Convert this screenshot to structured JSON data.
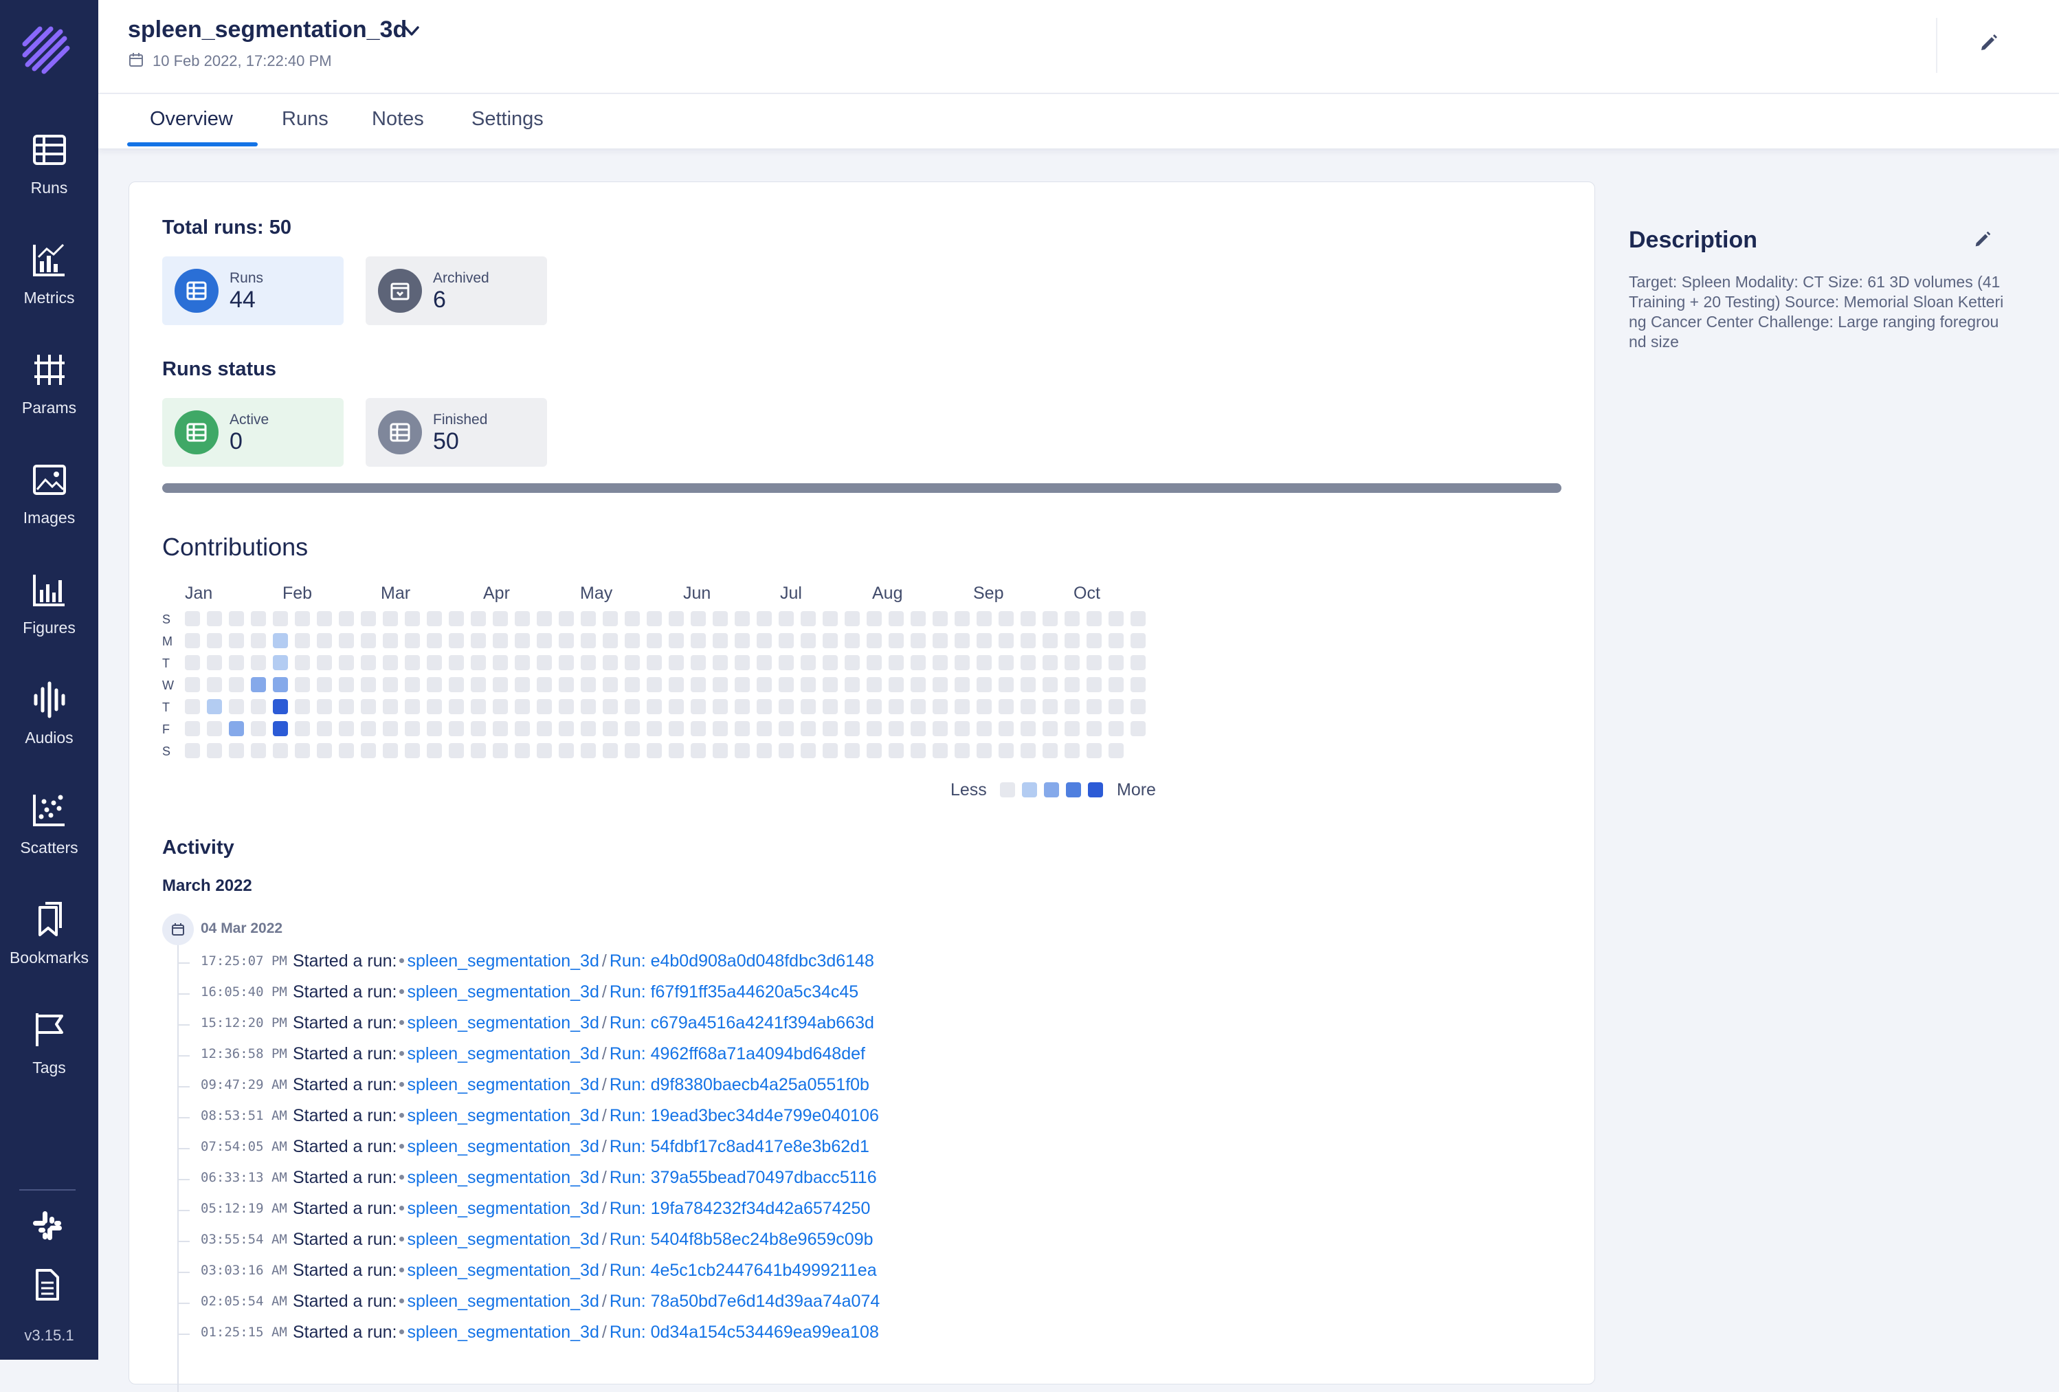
{
  "app": {
    "version": "v3.15.1"
  },
  "sidebar": {
    "items": [
      {
        "label": "Runs",
        "icon": "runs-table-icon"
      },
      {
        "label": "Metrics",
        "icon": "metrics-chart-icon"
      },
      {
        "label": "Params",
        "icon": "params-grid-icon"
      },
      {
        "label": "Images",
        "icon": "images-icon"
      },
      {
        "label": "Figures",
        "icon": "figures-chart-icon"
      },
      {
        "label": "Audios",
        "icon": "audio-wave-icon"
      },
      {
        "label": "Scatters",
        "icon": "scatter-icon"
      },
      {
        "label": "Bookmarks",
        "icon": "bookmark-icon"
      },
      {
        "label": "Tags",
        "icon": "flag-icon"
      }
    ],
    "footer_icons": [
      "slack-icon",
      "docs-icon"
    ]
  },
  "header": {
    "title": "spleen_segmentation_3d",
    "date": "10 Feb 2022, 17:22:40 PM"
  },
  "tabs": [
    {
      "label": "Overview",
      "active": true
    },
    {
      "label": "Runs",
      "active": false
    },
    {
      "label": "Notes",
      "active": false
    },
    {
      "label": "Settings",
      "active": false
    }
  ],
  "overview": {
    "total_runs_label": "Total runs: 50",
    "runs_card": {
      "label": "Runs",
      "value": "44"
    },
    "archived_card": {
      "label": "Archived",
      "value": "6"
    },
    "status_title": "Runs status",
    "active_card": {
      "label": "Active",
      "value": "0"
    },
    "finished_card": {
      "label": "Finished",
      "value": "50"
    },
    "finished_fraction": 1.0
  },
  "contributions": {
    "title": "Contributions",
    "months": [
      "Jan",
      "Feb",
      "Mar",
      "Apr",
      "May",
      "Jun",
      "Jul",
      "Aug",
      "Sep",
      "Oct"
    ],
    "weekdays": [
      "S",
      "M",
      "T",
      "W",
      "T",
      "F",
      "S"
    ],
    "weeks": 44,
    "last_week_days": 7,
    "last_row_weeks": 43,
    "highlights": [
      {
        "week": 1,
        "day": 4,
        "level": 1
      },
      {
        "week": 2,
        "day": 5,
        "level": 2
      },
      {
        "week": 3,
        "day": 3,
        "level": 2
      },
      {
        "week": 4,
        "day": 1,
        "level": 1
      },
      {
        "week": 4,
        "day": 2,
        "level": 1
      },
      {
        "week": 4,
        "day": 3,
        "level": 2
      },
      {
        "week": 4,
        "day": 4,
        "level": 4
      },
      {
        "week": 4,
        "day": 5,
        "level": 4
      }
    ],
    "legend_less": "Less",
    "legend_more": "More",
    "colors": [
      "#e6e8ee",
      "#b3ccf2",
      "#85a9ea",
      "#4f7fdf",
      "#2c5bd6"
    ]
  },
  "activity": {
    "title": "Activity",
    "month_group": "March 2022",
    "day": "04 Mar 2022",
    "action_text": "Started a run:",
    "experiment": "spleen_segmentation_3d",
    "entries": [
      {
        "time": "17:25:07 PM",
        "run": "Run: e4b0d908a0d048fdbc3d6148"
      },
      {
        "time": "16:05:40 PM",
        "run": "Run: f67f91ff35a44620a5c34c45"
      },
      {
        "time": "15:12:20 PM",
        "run": "Run: c679a4516a4241f394ab663d"
      },
      {
        "time": "12:36:58 PM",
        "run": "Run: 4962ff68a71a4094bd648def"
      },
      {
        "time": "09:47:29 AM",
        "run": "Run: d9f8380baecb4a25a0551f0b"
      },
      {
        "time": "08:53:51 AM",
        "run": "Run: 19ead3bec34d4e799e040106"
      },
      {
        "time": "07:54:05 AM",
        "run": "Run: 54fdbf17c8ad417e8e3b62d1"
      },
      {
        "time": "06:33:13 AM",
        "run": "Run: 379a55bead70497dbacc5116"
      },
      {
        "time": "05:12:19 AM",
        "run": "Run: 19fa784232f34d42a6574250"
      },
      {
        "time": "03:55:54 AM",
        "run": "Run: 5404f8b58ec24b8e9659c09b"
      },
      {
        "time": "03:03:16 AM",
        "run": "Run: 4e5c1cb2447641b4999211ea"
      },
      {
        "time": "02:05:54 AM",
        "run": "Run: 78a50bd7e6d14d39aa74a074"
      },
      {
        "time": "01:25:15 AM",
        "run": "Run: 0d34a154c534469ea99ea108"
      }
    ]
  },
  "description": {
    "title": "Description",
    "text": "Target: Spleen Modality: CT Size: 61 3D volumes (41 Training + 20 Testing) Source: Memorial Sloan Kettering Cancer Center Challenge: Large ranging foreground size"
  }
}
